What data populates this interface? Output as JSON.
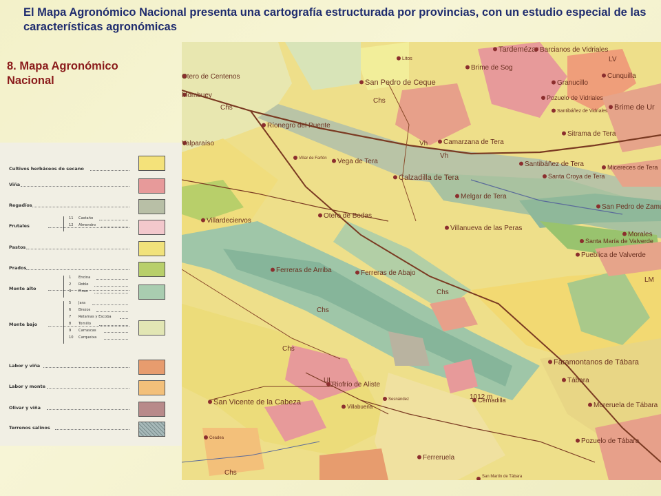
{
  "slide": {
    "title": "El Mapa Agronómico Nacional  presenta una cartografía estructurada por provincias, con un estudio especial de las características agronómicas",
    "subtitle": "8. Mapa Agronómico Nacional"
  },
  "legend": {
    "items": [
      {
        "label": "Cultivos herbáceos de secano",
        "color": "#f4e27a",
        "subs": []
      },
      {
        "label": "Viña",
        "color": "#e79a9a",
        "subs": []
      },
      {
        "label": "Regadíos",
        "color": "#b8bfa6",
        "subs": []
      },
      {
        "label": "Frutales",
        "color": "#f3c8cc",
        "subs": [
          {
            "num": "11",
            "text": "Castaño"
          },
          {
            "num": "12",
            "text": "Almendro"
          }
        ]
      },
      {
        "label": "Pastos",
        "color": "#f1e27b",
        "subs": []
      },
      {
        "label": "Prados",
        "color": "#b8cf6a",
        "subs": []
      },
      {
        "label": "Monte alto",
        "color": "#a9cdb0",
        "subs": [
          {
            "num": "1",
            "text": "Encina"
          },
          {
            "num": "2",
            "text": "Roble"
          },
          {
            "num": "3",
            "text": "Pinos"
          }
        ]
      },
      {
        "label": "Monte bajo",
        "color": "#e2e6b4",
        "subs": [
          {
            "num": "5",
            "text": "Jara"
          },
          {
            "num": "6",
            "text": "Brezos"
          },
          {
            "num": "7",
            "text": "Retamas y Escoba"
          },
          {
            "num": "8",
            "text": "Tomillo"
          },
          {
            "num": "9",
            "text": "Carrascas"
          },
          {
            "num": "10",
            "text": "Carqueixa"
          }
        ]
      },
      {
        "label": "Labor y viña",
        "color": "#e79c6e",
        "subs": []
      },
      {
        "label": "Labor y monte",
        "color": "#f3c07a",
        "subs": []
      },
      {
        "label": "Olivar y viña",
        "color": "#b88a8a",
        "subs": []
      },
      {
        "label": "Terrenos salinos",
        "color": "#a7b9b9",
        "subs": []
      }
    ]
  },
  "map": {
    "places": [
      "Tardemézar",
      "Barcianos de Vidriales",
      "Brime de Sog",
      "Granucillo",
      "Cunquilla",
      "Pozuelo de Vidriales",
      "Brime de Ur",
      "Santibáñez de Vidriales",
      "Sitrama de Tera",
      "San Pedro de Ceque",
      "Mombuey",
      "Ríonegro del Puente",
      "Camarzana de Tera",
      "Valparaíso",
      "Vega de Tera",
      "Santibáñez de Tera",
      "Micereces de Tera",
      "Calzadilla de Tera",
      "Santa Croya de Tera",
      "Melgar de Tera",
      "San Pedro de Zamudia",
      "Villardeciervos",
      "Otero de Bodas",
      "Villanueva de las Peras",
      "Santa María de Valverde",
      "Morales",
      "Pueblica de Valverde",
      "Ferreras de Arriba",
      "Ferreras de Abajo",
      "Faramontanos de Tábara",
      "Tábara",
      "Moreruela de Tábara",
      "Riofrío de Aliste",
      "San Vicente de la Cabeza",
      "Pozuelo de Tábara",
      "Ferreruela",
      "Cernadilla",
      "Villabuena",
      "Otero de Centenos",
      "Villar de Farfón",
      "Sesnández",
      "Ceadea",
      "San Martín de Tábara",
      "Litos"
    ],
    "labels": {
      "chs": "Chs",
      "vh": "Vh",
      "lm": "LM",
      "lv": "LV",
      "altitude": "1012 m",
      "ul": "UL"
    }
  },
  "colors": {
    "title": "#1f2c6e",
    "subtitle": "#8a1b1b"
  }
}
